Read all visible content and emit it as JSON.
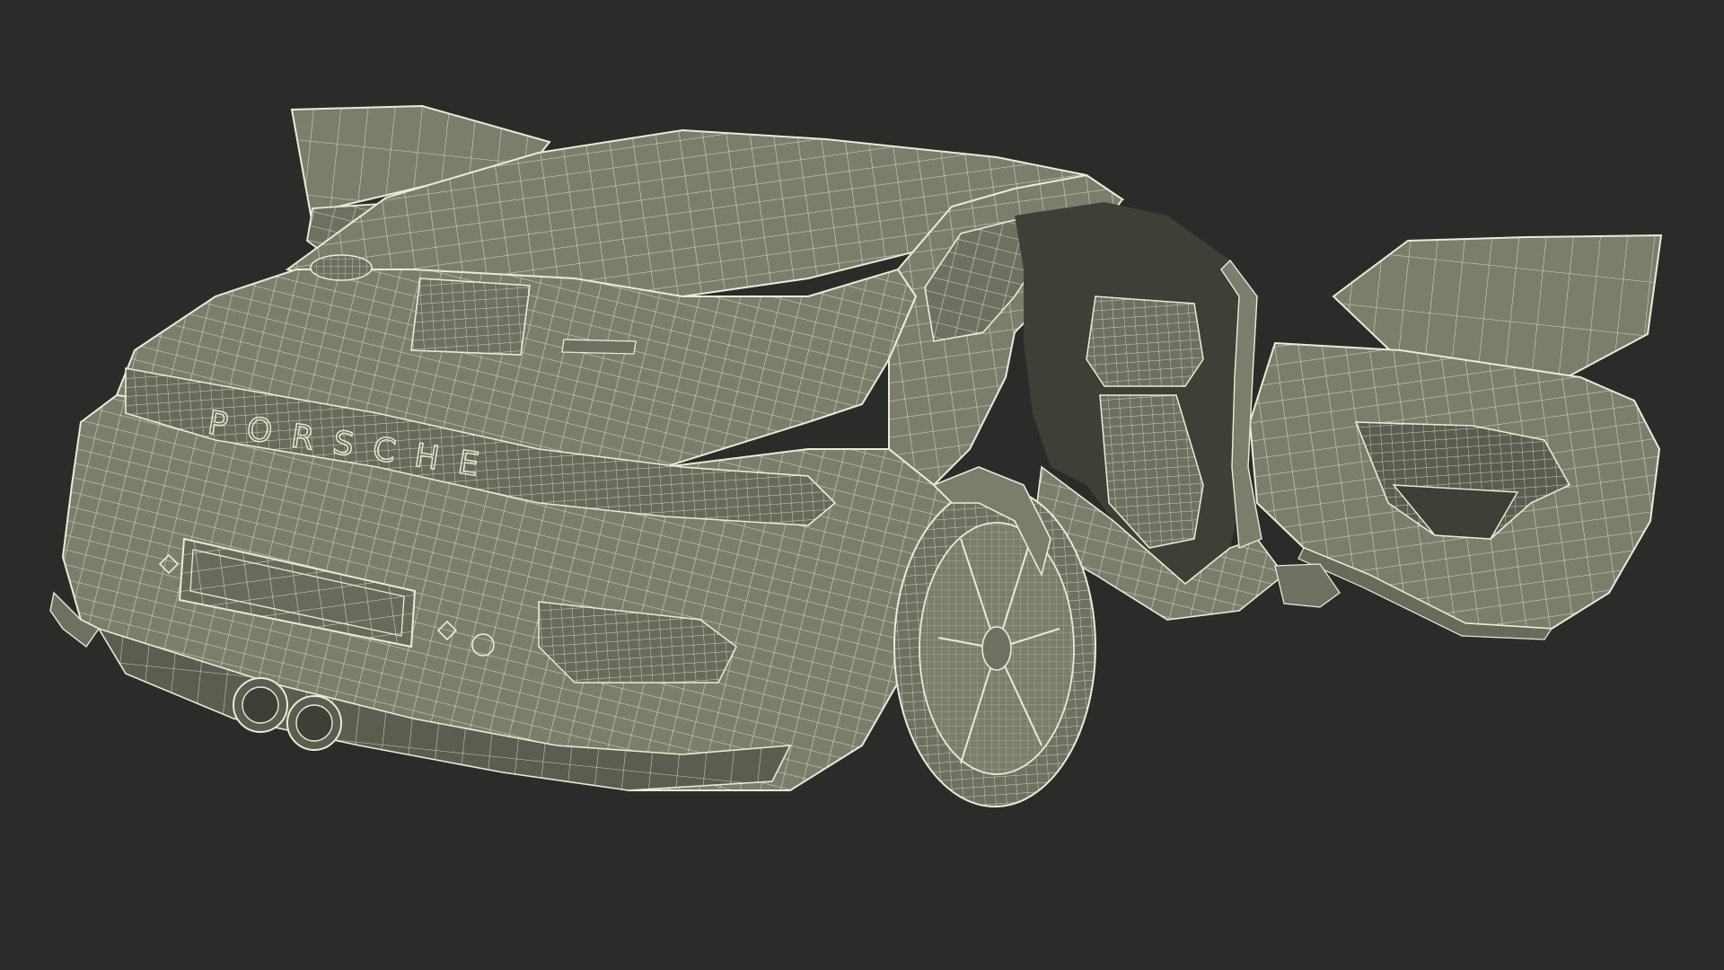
{
  "scene": {
    "background_color": "#2b2b29",
    "surface_color": "#7d7d6e",
    "surface_shadow_color": "#5c5c50",
    "cavity_color": "#3f3f37",
    "wire_color": "#ecebd9",
    "wire_opacity": 0.85
  },
  "model": {
    "brand_lettering": "PORSCHE"
  }
}
